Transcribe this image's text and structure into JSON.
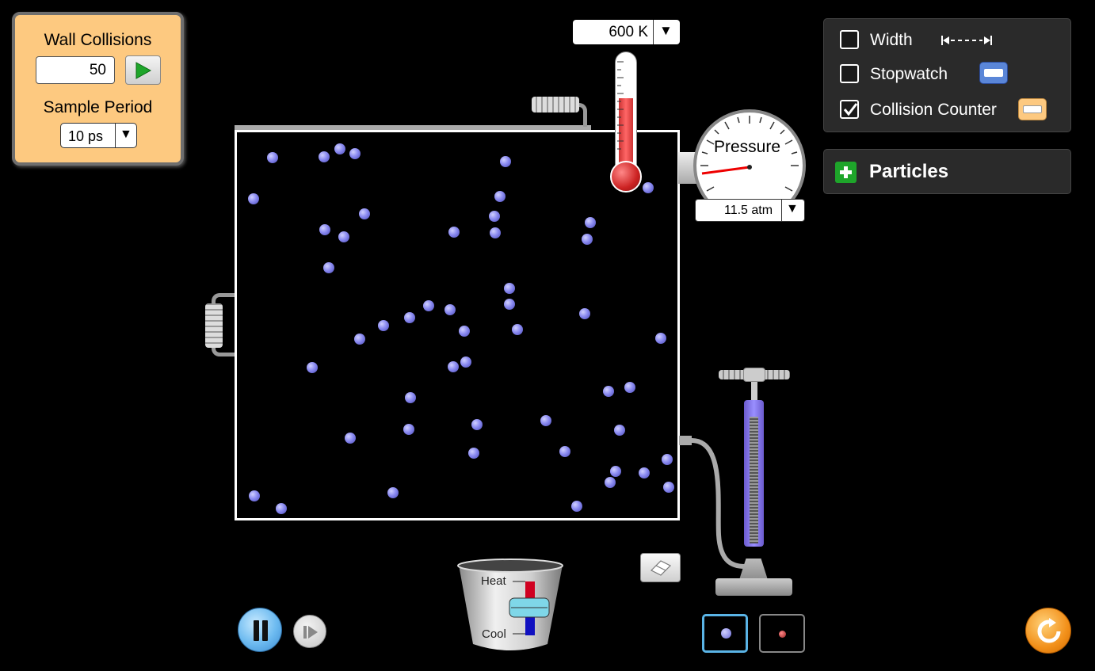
{
  "wall_collisions": {
    "title": "Wall Collisions",
    "value": "50",
    "sample_period_label": "Sample Period",
    "sample_period_value": "10 ps"
  },
  "thermometer": {
    "value": "600 K"
  },
  "pressure": {
    "label": "Pressure",
    "value": "11.5 atm"
  },
  "options": {
    "width_label": "Width",
    "width_checked": false,
    "stopwatch_label": "Stopwatch",
    "stopwatch_checked": false,
    "collision_counter_label": "Collision Counter",
    "collision_counter_checked": true
  },
  "particles_panel": {
    "label": "Particles"
  },
  "bucket": {
    "heat_label": "Heat",
    "cool_label": "Cool"
  },
  "colors": {
    "particle": "#8a8af0",
    "panel_bg": "#fdc980",
    "stopwatch_icon": "#5a86d8",
    "counter_icon": "#fdc980",
    "thermometer": "#cc3333",
    "pump": "#6a5acd"
  },
  "icons": [
    "play-icon",
    "dropdown-arrow-icon",
    "checkmark-icon",
    "width-arrows-icon",
    "plus-icon",
    "eraser-icon",
    "pause-icon",
    "step-icon",
    "reset-icon"
  ]
}
